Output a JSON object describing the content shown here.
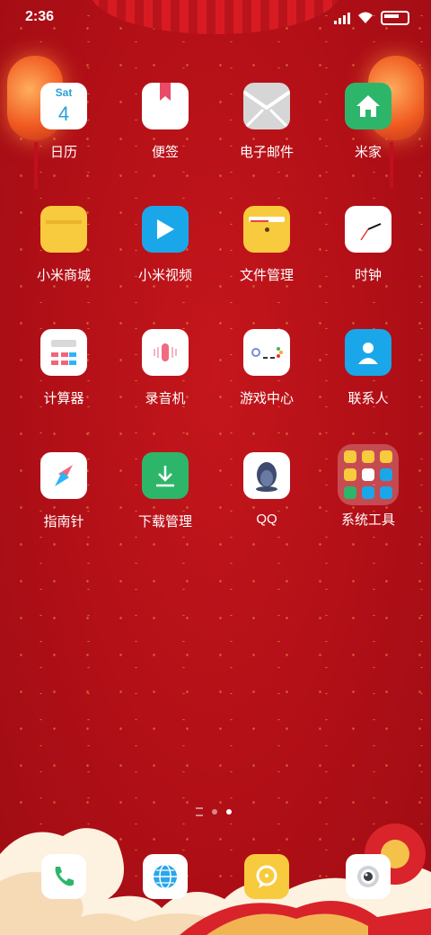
{
  "status": {
    "time": "2:36"
  },
  "calendar": {
    "day": "Sat",
    "date": "4"
  },
  "apps": [
    {
      "name": "calendar",
      "label": "日历"
    },
    {
      "name": "notes",
      "label": "便签"
    },
    {
      "name": "email",
      "label": "电子邮件"
    },
    {
      "name": "mi-home",
      "label": "米家"
    },
    {
      "name": "mi-store",
      "label": "小米商城"
    },
    {
      "name": "mi-video",
      "label": "小米视频"
    },
    {
      "name": "file-manager",
      "label": "文件管理"
    },
    {
      "name": "clock",
      "label": "时钟"
    },
    {
      "name": "calculator",
      "label": "计算器"
    },
    {
      "name": "recorder",
      "label": "录音机"
    },
    {
      "name": "game-center",
      "label": "游戏中心"
    },
    {
      "name": "contacts",
      "label": "联系人"
    },
    {
      "name": "compass",
      "label": "指南针"
    },
    {
      "name": "downloads",
      "label": "下载管理"
    },
    {
      "name": "qq",
      "label": "QQ"
    },
    {
      "name": "system-tools",
      "label": "系统工具"
    }
  ],
  "dock": [
    {
      "name": "phone",
      "icon": "phone-icon"
    },
    {
      "name": "browser",
      "icon": "globe-icon"
    },
    {
      "name": "messages",
      "icon": "chat-bubble-icon"
    },
    {
      "name": "camera",
      "icon": "camera-icon"
    }
  ],
  "pager": {
    "pages": 2,
    "current": 2
  },
  "colors": {
    "wallpaper": "#b10f17",
    "green": "#2db66a",
    "yellow": "#f8ca3d",
    "blue": "#1aa7ea"
  }
}
